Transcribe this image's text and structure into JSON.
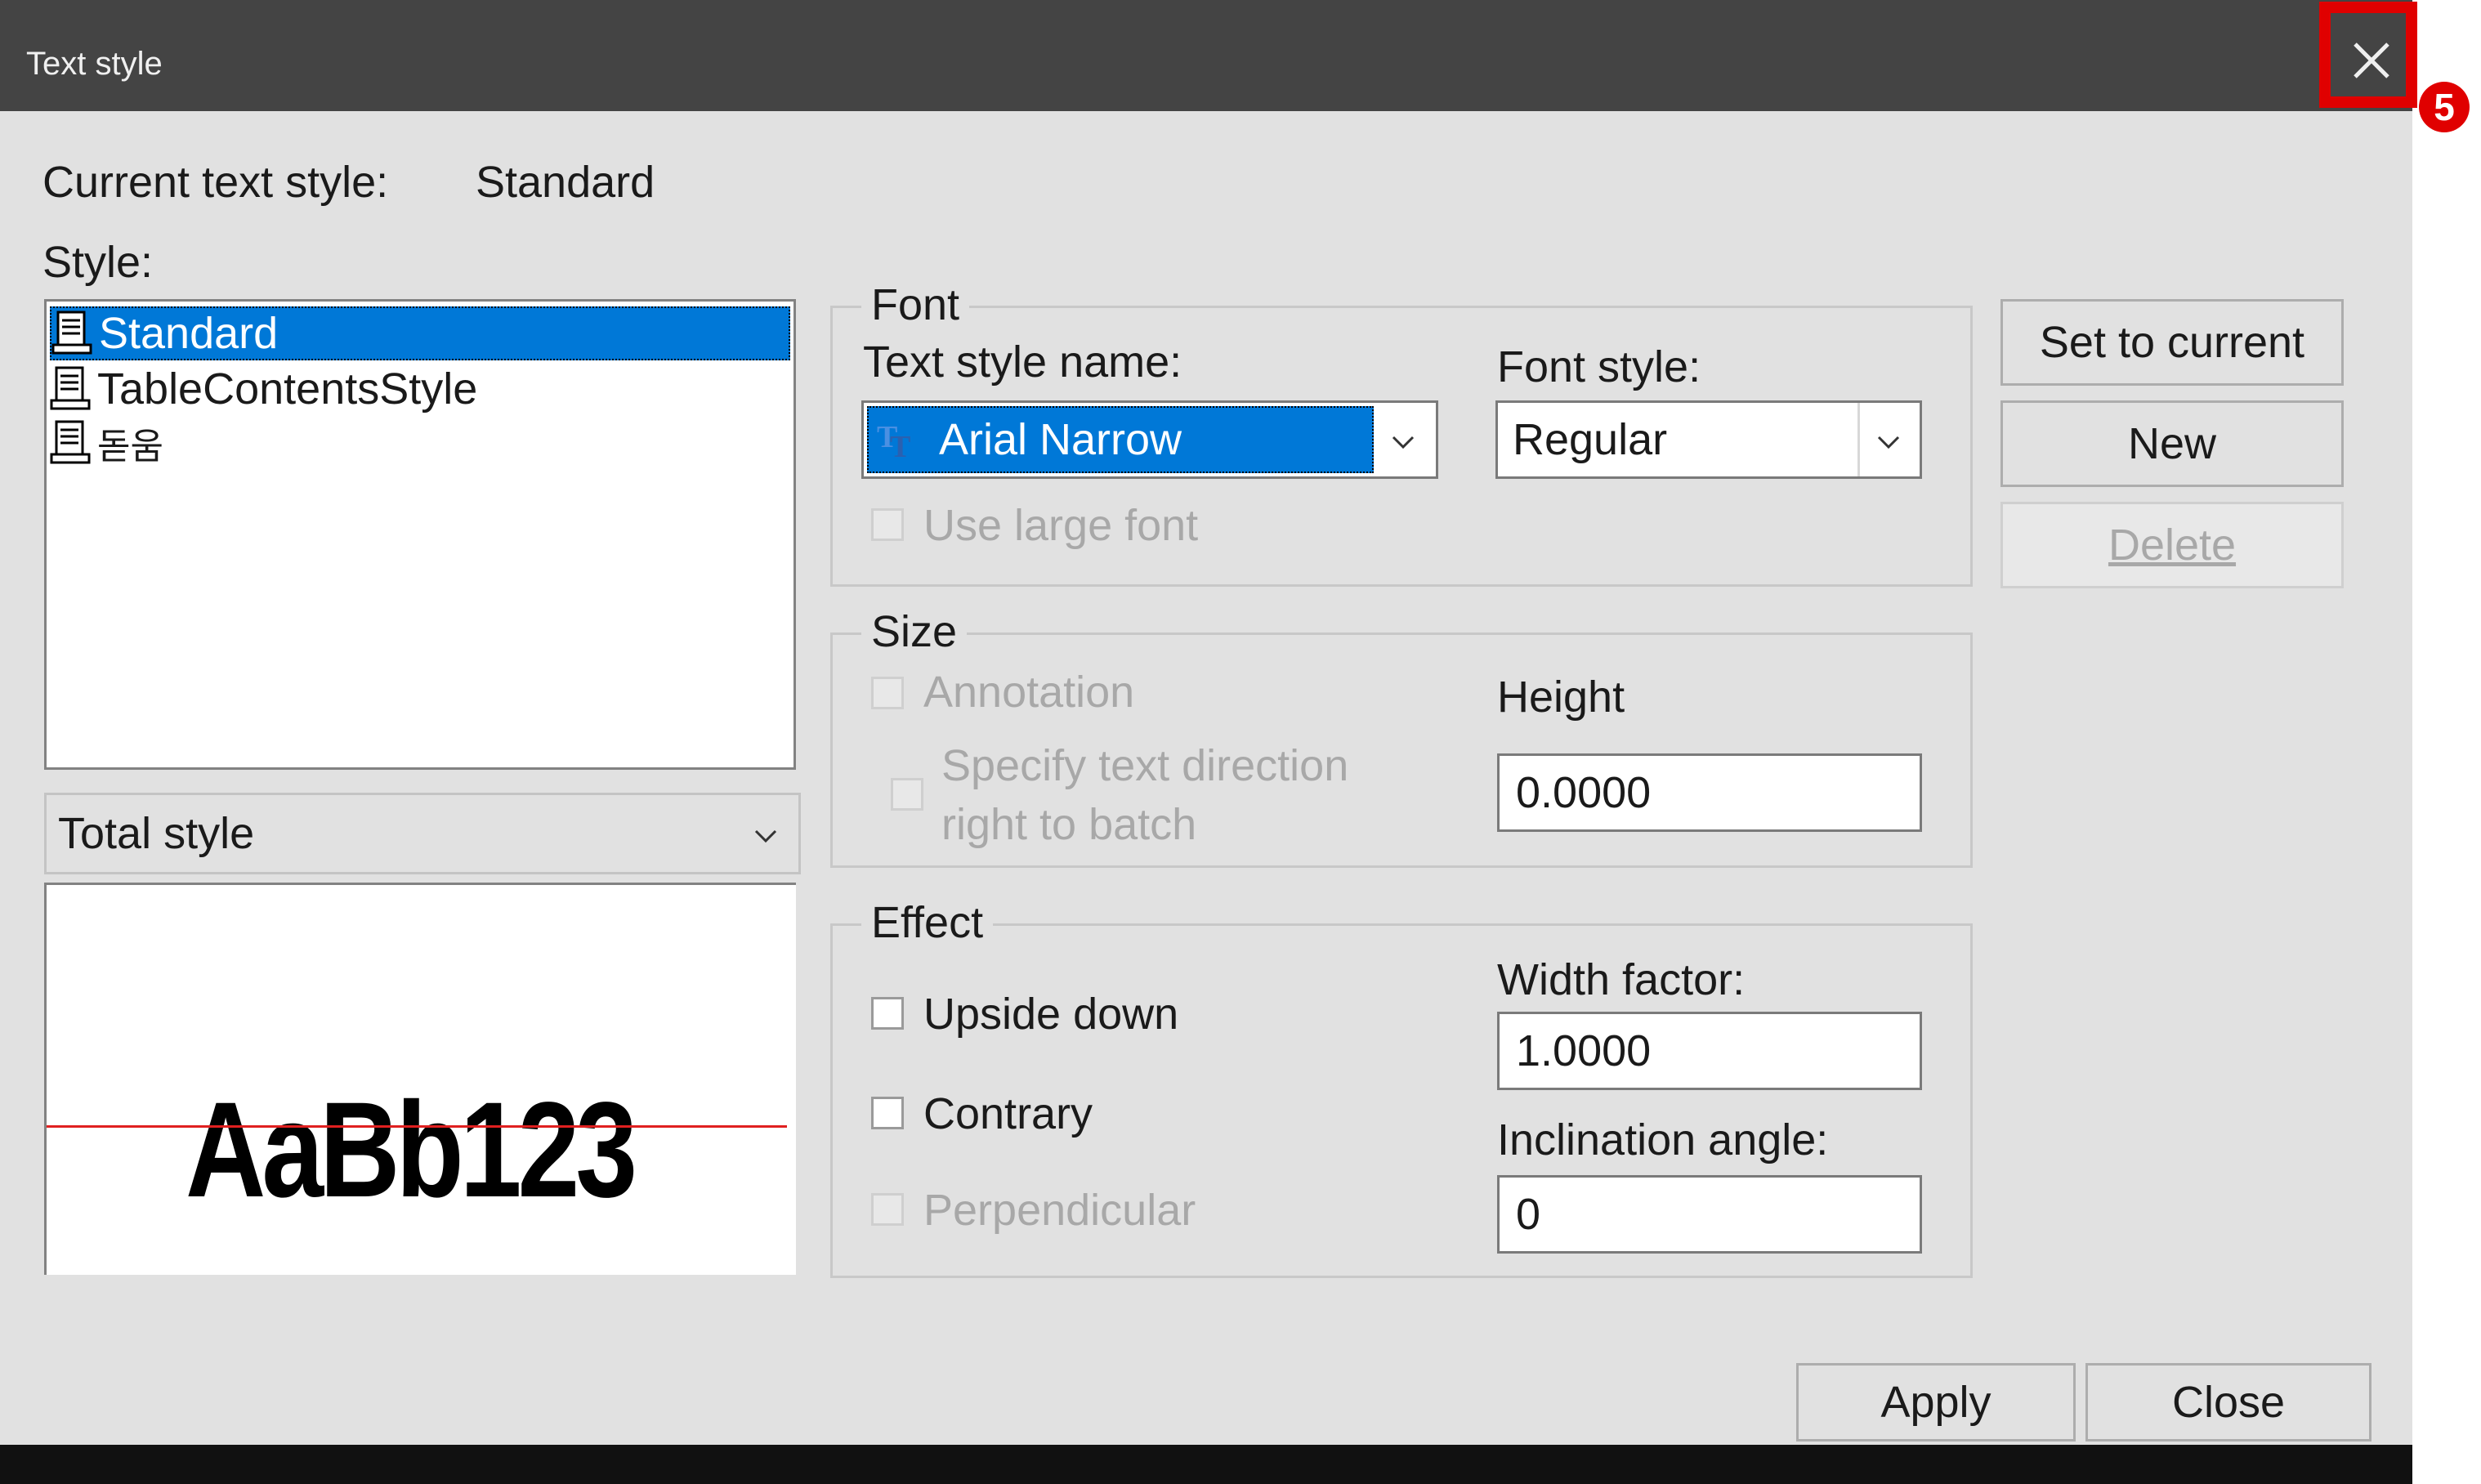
{
  "window": {
    "title": "Text style",
    "badge": "5"
  },
  "current": {
    "label": "Current text style:",
    "value": "Standard"
  },
  "style_list": {
    "label": "Style:",
    "items": [
      {
        "label": "Standard",
        "selected": true
      },
      {
        "label": "TableContentsStyle",
        "selected": false
      },
      {
        "label": "돋움",
        "selected": false
      }
    ]
  },
  "filter_combo": {
    "value": "Total style"
  },
  "preview": {
    "sample": "AaBb123"
  },
  "font_group": {
    "title": "Font",
    "name_label": "Text style name:",
    "name_value": "Arial Narrow",
    "style_label": "Font style:",
    "style_value": "Regular",
    "large_font_label": "Use large font"
  },
  "size_group": {
    "title": "Size",
    "annotation_label": "Annotation",
    "direction_label_1": "Specify text direction",
    "direction_label_2": "right to batch",
    "height_label": "Height",
    "height_value": "0.0000"
  },
  "effect_group": {
    "title": "Effect",
    "upside_down_label": "Upside down",
    "contrary_label": "Contrary",
    "perpendicular_label": "Perpendicular",
    "width_factor_label": "Width factor:",
    "width_factor_value": "1.0000",
    "inclination_label": "Inclination angle:",
    "inclination_value": "0"
  },
  "side_buttons": {
    "set_current": "Set to current",
    "new": "New",
    "delete": "Delete"
  },
  "footer": {
    "apply": "Apply",
    "close": "Close"
  },
  "colors": {
    "title_bar": "#444444",
    "selection": "#0078d7",
    "highlight": "#e00000",
    "baseline": "#e02020"
  }
}
